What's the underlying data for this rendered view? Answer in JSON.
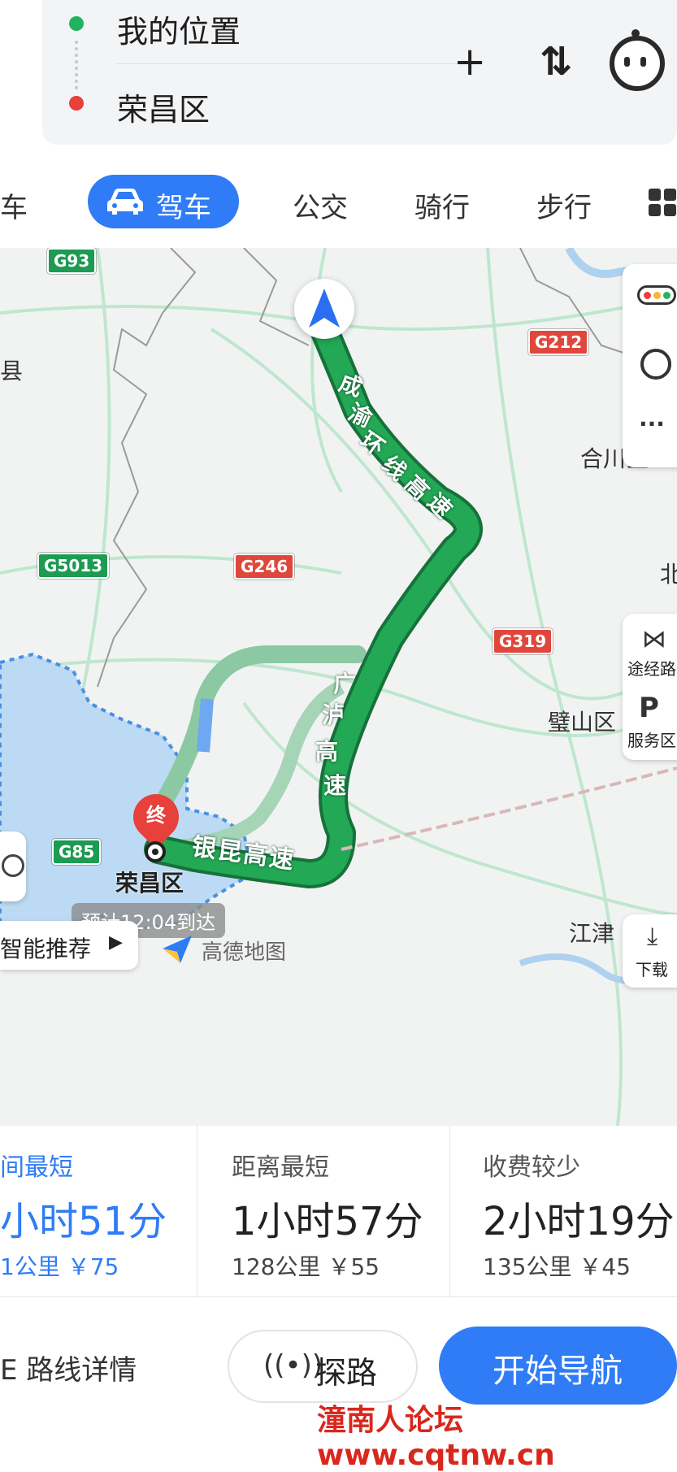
{
  "origin": {
    "label": "我的位置"
  },
  "destination": {
    "label": "荣昌区"
  },
  "header_icons": {
    "add": "+",
    "swap": "⇅",
    "assistant": "robot-icon"
  },
  "tabs": [
    {
      "label": "车",
      "active": false
    },
    {
      "label": "驾车",
      "active": true
    },
    {
      "label": "公交",
      "active": false
    },
    {
      "label": "骑行",
      "active": false
    },
    {
      "label": "步行",
      "active": false
    }
  ],
  "map": {
    "shields": [
      "G93",
      "G212",
      "G5013",
      "G246",
      "G319",
      "G85"
    ],
    "places": [
      "县",
      "合川区",
      "北",
      "璧山区",
      "江津"
    ],
    "roads": {
      "road1": [
        "成",
        "渝",
        "环",
        "线",
        "高",
        "速"
      ],
      "road2": [
        "广",
        "泸",
        "高",
        "速"
      ],
      "road3": "银昆高速"
    },
    "destination_pin": "终",
    "destination_label": "荣昌区",
    "eta": "预计12:04到达",
    "recommend": "智能推荐",
    "brand": "高德地图",
    "side_buttons": {
      "waypoint": "途经路",
      "service": "服务区",
      "download": "下载",
      "more": "···"
    }
  },
  "route_options": [
    {
      "title": "间最短",
      "time": "小时51分",
      "sub": "1公里 ￥75",
      "selected": true
    },
    {
      "title": "距离最短",
      "time": "1小时57分",
      "sub": "128公里 ￥55",
      "selected": false
    },
    {
      "title": "收费较少",
      "time": "2小时19分",
      "sub": "135公里 ￥45",
      "selected": false
    }
  ],
  "actions": {
    "details": "E 路线详情",
    "explore": "探路",
    "start": "开始导航"
  },
  "watermark": "潼南人论坛www.cqtnw.cn",
  "colors": {
    "accent": "#2f7cf6",
    "route": "#1f9a4f",
    "alt_route": "#8cc9a3",
    "start_dot": "#22b35e",
    "end_dot": "#e8403a"
  }
}
